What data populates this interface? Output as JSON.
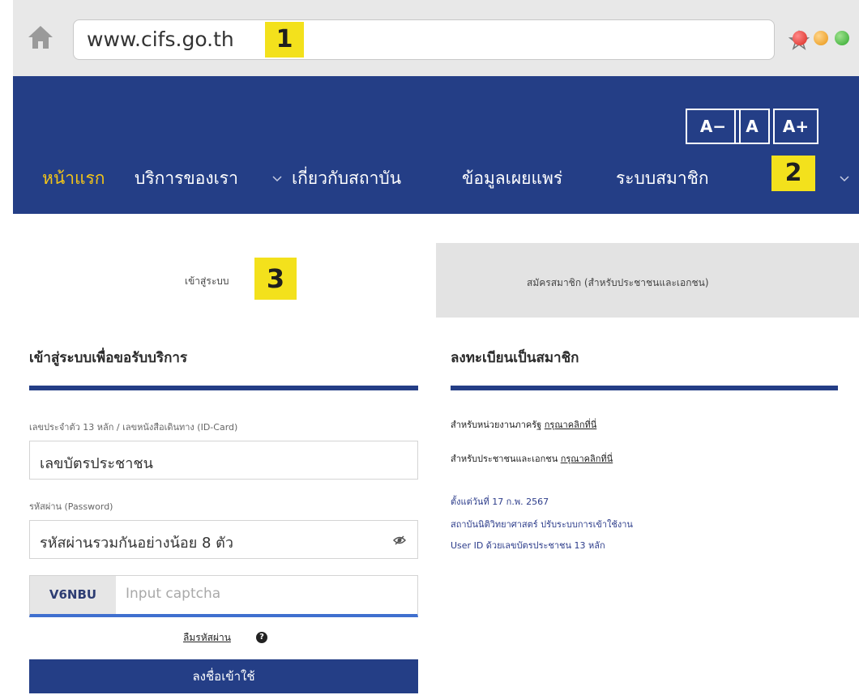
{
  "browser": {
    "url": "www.cifs.go.th",
    "callout_1": "1",
    "icons": {
      "home": "home-icon",
      "bookmark": "star-icon"
    }
  },
  "header": {
    "font_sizes": [
      "A−",
      "A",
      "A+"
    ],
    "menu": [
      {
        "label": "หน้าแรก",
        "active": true
      },
      {
        "label": "บริการของเรา",
        "dropdown": true
      },
      {
        "label": "เกี่ยวกับสถาบัน"
      },
      {
        "label": "ข้อมูลเผยแพร่"
      },
      {
        "label": "ระบบสมาชิก",
        "dropdown": true
      }
    ],
    "callout_2": "2",
    "colors": {
      "nav_bg": "#243e86",
      "active": "#f3c518"
    }
  },
  "tabs": {
    "login": "เข้าสู่ระบบ",
    "register": "สมัครสมาชิก (สำหรับประชาชนและเอกชน)",
    "callout_3": "3"
  },
  "login_panel": {
    "title": "เข้าสู่ระบบเพื่อขอรับบริการ",
    "id_label": "เลขประจำตัว 13 หลัก / เลขหนังสือเดินทาง (ID-Card)",
    "id_placeholder": "เลขบัตรประชาชน",
    "password_label": "รหัสผ่าน (Password)",
    "password_placeholder": "รหัสผ่านรวมกันอย่างน้อย 8 ตัว",
    "captcha_code": "V6NBU",
    "captcha_placeholder": "Input captcha",
    "forgot": "ลืมรหัสผ่าน",
    "help_icon": "?",
    "submit": "ลงชื่อเข้าใช้"
  },
  "register_panel": {
    "title": "ลงทะเบียนเป็นสมาชิก",
    "gov_text": "สำหรับหน่วยงานภาครัฐ",
    "gov_link": "กรุณาคลิกที่นี่",
    "public_text": "สำหรับประชาชนและเอกชน",
    "public_link": "กรุณาคลิกที่นี่",
    "notice": [
      "ตั้งแต่วันที่ 17 ก.พ. 2567",
      "สถาบันนิติวิทยาศาสตร์ ปรับระบบการเข้าใช้งาน",
      "User ID ด้วยเลขบัตรประชาชน 13 หลัก"
    ]
  }
}
